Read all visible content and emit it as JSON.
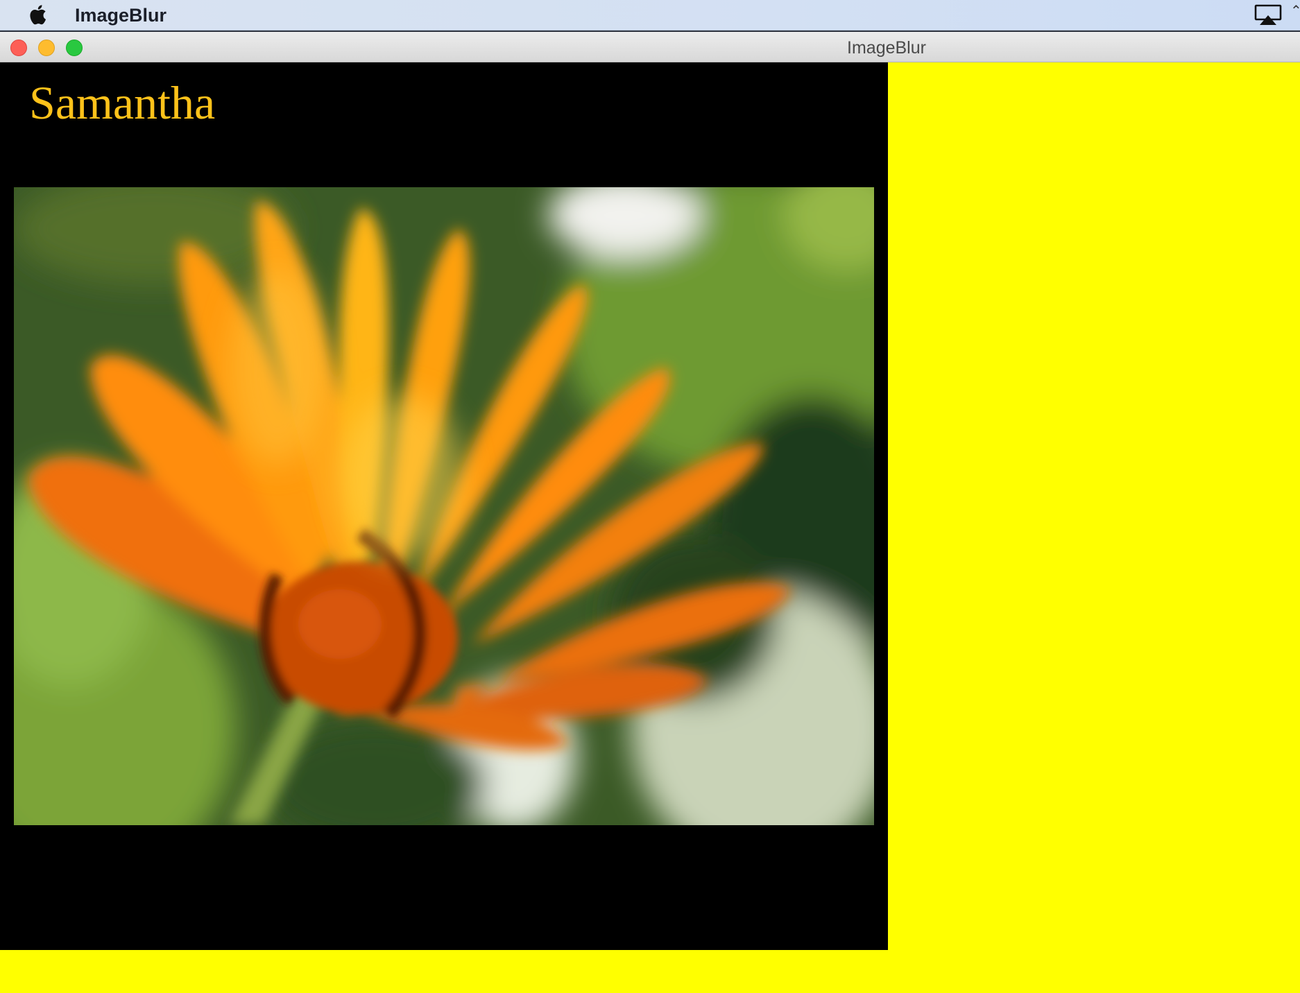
{
  "menubar": {
    "app_name": "ImageBlur",
    "edge_glyph": "⌃",
    "icons": [
      "apple-icon",
      "airplay-icon"
    ]
  },
  "window": {
    "title": "ImageBlur",
    "buttons": [
      "close-button",
      "minimize-button",
      "zoom-button"
    ]
  },
  "content": {
    "heading": "Samantha",
    "image": {
      "subject": "blurred orange flower photo"
    }
  },
  "colors": {
    "background_yellow": "#ffff00",
    "panel_black": "#000000",
    "heading_gold": "#ffc21a",
    "close_red": "#fd5f57",
    "minimize_yellow": "#febc2e",
    "zoom_green": "#29c840"
  }
}
